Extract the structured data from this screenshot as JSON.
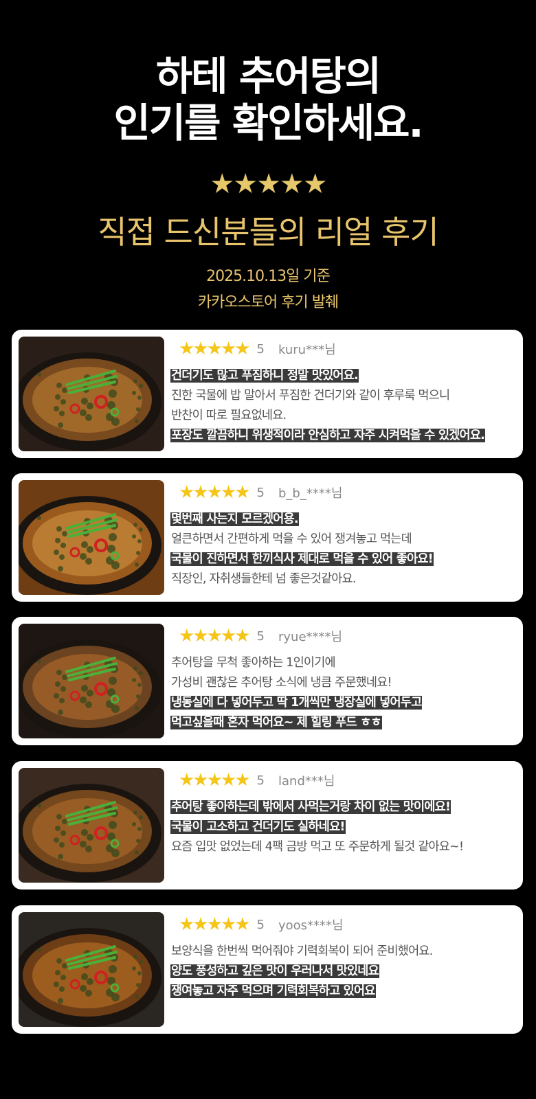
{
  "header": {
    "title_line1": "하테 추어탕의",
    "title_line2": "인기를 확인하세요.",
    "stars": "★★★★★",
    "subtitle": "직접 드신분들의 리얼 후기",
    "date": "2025.10.13일 기준",
    "source": "카카오스토어 후기 발췌"
  },
  "colors": {
    "background": "#000000",
    "gold": "#e8c46c",
    "star_yellow": "#f5c518",
    "highlight_bg": "#3a3a3a"
  },
  "reviews": [
    {
      "stars": "★★★★★",
      "score": "5",
      "user": "kuru***님",
      "lines": [
        {
          "text": "건더기도 많고 푸짐하니 정말 맛있어요.",
          "highlight": true
        },
        {
          "text": "진한 국물에 밥 말아서 푸짐한 건더기와 같이 후루룩 먹으니",
          "highlight": false
        },
        {
          "text": "반찬이 따로 필요없네요.",
          "highlight": false
        },
        {
          "text": "포장도 깔끔하니 위생적이라 안심하고 자주 시켜먹을 수 있겠어요.",
          "highlight": true
        }
      ]
    },
    {
      "stars": "★★★★★",
      "score": "5",
      "user": "b_b_****님",
      "lines": [
        {
          "text": "몇번째 사는지 모르겠어용.",
          "highlight": true
        },
        {
          "text": "얼큰하면서 간편하게 먹을 수 있어 쟁겨놓고 먹는데",
          "highlight": false
        },
        {
          "text": "국물이 진하면서 한끼식사 제대로 먹을 수 있어 좋아요!",
          "highlight": true
        },
        {
          "text": "직장인, 자취생들한테 넘 좋은것같아요.",
          "highlight": false
        }
      ]
    },
    {
      "stars": "★★★★★",
      "score": "5",
      "user": "ryue****님",
      "lines": [
        {
          "text": "추어탕을 무척 좋아하는 1인이기에",
          "highlight": false
        },
        {
          "text": "가성비 괜찮은 추어탕 소식에 냉큼 주문했네요!",
          "highlight": false
        },
        {
          "text": "냉동실에 다 넣어두고 딱 1개씩만 냉장실에 넣어두고",
          "highlight": true
        },
        {
          "text": "먹고싶을때 혼자 먹어요~ 제 힐링 푸드 ㅎㅎ",
          "highlight": true
        }
      ]
    },
    {
      "stars": "★★★★★",
      "score": "5",
      "user": "land***님",
      "lines": [
        {
          "text": "추어탕 좋아하는데 밖에서 사먹는거랑 차이 없는 맛이에요!",
          "highlight": true
        },
        {
          "text": "국물이 고소하고 건더기도 실하네요!",
          "highlight": true
        },
        {
          "text": "요즘 입맛 없었는데 4팩 금방 먹고 또 주문하게 될것 같아요~!",
          "highlight": false
        }
      ]
    },
    {
      "stars": "★★★★★",
      "score": "5",
      "user": "yoos****님",
      "lines": [
        {
          "text": "보양식을 한번씩 먹어줘야 기력회복이 되어 준비했어요.",
          "highlight": false
        },
        {
          "text": "양도 풍성하고 깊은 맛이 우러나서 맛있네요",
          "highlight": true
        },
        {
          "text": "쟁여놓고 자주 먹으며 기력회복하고 있어요",
          "highlight": true
        }
      ]
    }
  ]
}
